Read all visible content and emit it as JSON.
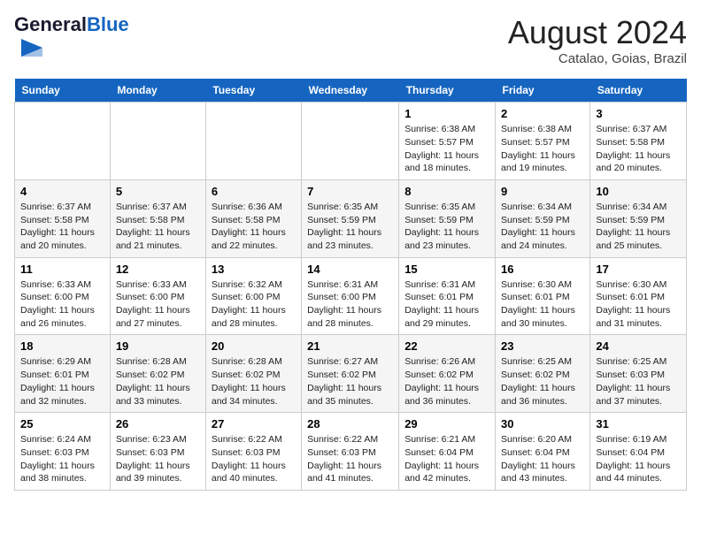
{
  "header": {
    "logo_general": "General",
    "logo_blue": "Blue",
    "month_title": "August 2024",
    "location": "Catalao, Goias, Brazil"
  },
  "weekdays": [
    "Sunday",
    "Monday",
    "Tuesday",
    "Wednesday",
    "Thursday",
    "Friday",
    "Saturday"
  ],
  "weeks": [
    [
      {
        "day": "",
        "info": ""
      },
      {
        "day": "",
        "info": ""
      },
      {
        "day": "",
        "info": ""
      },
      {
        "day": "",
        "info": ""
      },
      {
        "day": "1",
        "info": "Sunrise: 6:38 AM\nSunset: 5:57 PM\nDaylight: 11 hours and 18 minutes."
      },
      {
        "day": "2",
        "info": "Sunrise: 6:38 AM\nSunset: 5:57 PM\nDaylight: 11 hours and 19 minutes."
      },
      {
        "day": "3",
        "info": "Sunrise: 6:37 AM\nSunset: 5:58 PM\nDaylight: 11 hours and 20 minutes."
      }
    ],
    [
      {
        "day": "4",
        "info": "Sunrise: 6:37 AM\nSunset: 5:58 PM\nDaylight: 11 hours and 20 minutes."
      },
      {
        "day": "5",
        "info": "Sunrise: 6:37 AM\nSunset: 5:58 PM\nDaylight: 11 hours and 21 minutes."
      },
      {
        "day": "6",
        "info": "Sunrise: 6:36 AM\nSunset: 5:58 PM\nDaylight: 11 hours and 22 minutes."
      },
      {
        "day": "7",
        "info": "Sunrise: 6:35 AM\nSunset: 5:59 PM\nDaylight: 11 hours and 23 minutes."
      },
      {
        "day": "8",
        "info": "Sunrise: 6:35 AM\nSunset: 5:59 PM\nDaylight: 11 hours and 23 minutes."
      },
      {
        "day": "9",
        "info": "Sunrise: 6:34 AM\nSunset: 5:59 PM\nDaylight: 11 hours and 24 minutes."
      },
      {
        "day": "10",
        "info": "Sunrise: 6:34 AM\nSunset: 5:59 PM\nDaylight: 11 hours and 25 minutes."
      }
    ],
    [
      {
        "day": "11",
        "info": "Sunrise: 6:33 AM\nSunset: 6:00 PM\nDaylight: 11 hours and 26 minutes."
      },
      {
        "day": "12",
        "info": "Sunrise: 6:33 AM\nSunset: 6:00 PM\nDaylight: 11 hours and 27 minutes."
      },
      {
        "day": "13",
        "info": "Sunrise: 6:32 AM\nSunset: 6:00 PM\nDaylight: 11 hours and 28 minutes."
      },
      {
        "day": "14",
        "info": "Sunrise: 6:31 AM\nSunset: 6:00 PM\nDaylight: 11 hours and 28 minutes."
      },
      {
        "day": "15",
        "info": "Sunrise: 6:31 AM\nSunset: 6:01 PM\nDaylight: 11 hours and 29 minutes."
      },
      {
        "day": "16",
        "info": "Sunrise: 6:30 AM\nSunset: 6:01 PM\nDaylight: 11 hours and 30 minutes."
      },
      {
        "day": "17",
        "info": "Sunrise: 6:30 AM\nSunset: 6:01 PM\nDaylight: 11 hours and 31 minutes."
      }
    ],
    [
      {
        "day": "18",
        "info": "Sunrise: 6:29 AM\nSunset: 6:01 PM\nDaylight: 11 hours and 32 minutes."
      },
      {
        "day": "19",
        "info": "Sunrise: 6:28 AM\nSunset: 6:02 PM\nDaylight: 11 hours and 33 minutes."
      },
      {
        "day": "20",
        "info": "Sunrise: 6:28 AM\nSunset: 6:02 PM\nDaylight: 11 hours and 34 minutes."
      },
      {
        "day": "21",
        "info": "Sunrise: 6:27 AM\nSunset: 6:02 PM\nDaylight: 11 hours and 35 minutes."
      },
      {
        "day": "22",
        "info": "Sunrise: 6:26 AM\nSunset: 6:02 PM\nDaylight: 11 hours and 36 minutes."
      },
      {
        "day": "23",
        "info": "Sunrise: 6:25 AM\nSunset: 6:02 PM\nDaylight: 11 hours and 36 minutes."
      },
      {
        "day": "24",
        "info": "Sunrise: 6:25 AM\nSunset: 6:03 PM\nDaylight: 11 hours and 37 minutes."
      }
    ],
    [
      {
        "day": "25",
        "info": "Sunrise: 6:24 AM\nSunset: 6:03 PM\nDaylight: 11 hours and 38 minutes."
      },
      {
        "day": "26",
        "info": "Sunrise: 6:23 AM\nSunset: 6:03 PM\nDaylight: 11 hours and 39 minutes."
      },
      {
        "day": "27",
        "info": "Sunrise: 6:22 AM\nSunset: 6:03 PM\nDaylight: 11 hours and 40 minutes."
      },
      {
        "day": "28",
        "info": "Sunrise: 6:22 AM\nSunset: 6:03 PM\nDaylight: 11 hours and 41 minutes."
      },
      {
        "day": "29",
        "info": "Sunrise: 6:21 AM\nSunset: 6:04 PM\nDaylight: 11 hours and 42 minutes."
      },
      {
        "day": "30",
        "info": "Sunrise: 6:20 AM\nSunset: 6:04 PM\nDaylight: 11 hours and 43 minutes."
      },
      {
        "day": "31",
        "info": "Sunrise: 6:19 AM\nSunset: 6:04 PM\nDaylight: 11 hours and 44 minutes."
      }
    ]
  ]
}
